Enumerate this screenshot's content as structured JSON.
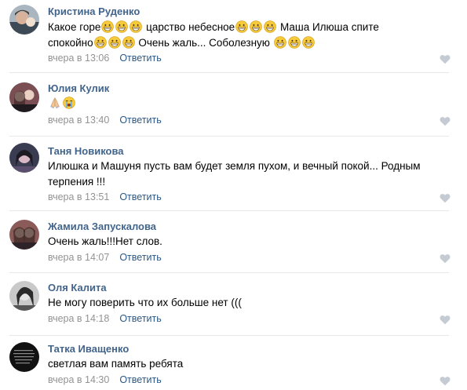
{
  "comments": [
    {
      "author": "Кристина Руденко",
      "line1_a": "Какое горе",
      "line1_b": " царство небесное",
      "line1_c": " Маша Илюша спите",
      "line2_a": "спокойно",
      "line2_b": " Очень жаль... Соболезную ",
      "time": "вчера в 13:06",
      "reply": "Ответить"
    },
    {
      "author": "Юлия Кулик",
      "time": "вчера в 13:40",
      "reply": "Ответить"
    },
    {
      "author": "Таня Новикова",
      "line1": "Илюшка и Машуня пусть вам будет земля пухом, и вечный покой... Родным",
      "line2": "терпения !!!",
      "time": "вчера в 13:51",
      "reply": "Ответить"
    },
    {
      "author": "Жамила Запускалова",
      "line1": "Очень жаль!!!Нет слов.",
      "time": "вчера в 14:07",
      "reply": "Ответить"
    },
    {
      "author": "Оля Калита",
      "line1": "Не могу поверить что их больше нет (((",
      "time": "вчера в 14:18",
      "reply": "Ответить"
    },
    {
      "author": "Татка Иващенко",
      "line1": "светлая вам память ребята",
      "time": "вчера в 14:30",
      "reply": "Ответить"
    }
  ],
  "icons": {
    "grin": "grinning-emoji-icon",
    "pray": "folded-hands-emoji-icon",
    "sob": "loudly-crying-emoji-icon",
    "like": "heart-icon"
  },
  "colors": {
    "author": "#42648b",
    "reply": "#2a5885",
    "time": "#939393",
    "like": "#c5cbd3",
    "divider": "#e7e8ec"
  }
}
